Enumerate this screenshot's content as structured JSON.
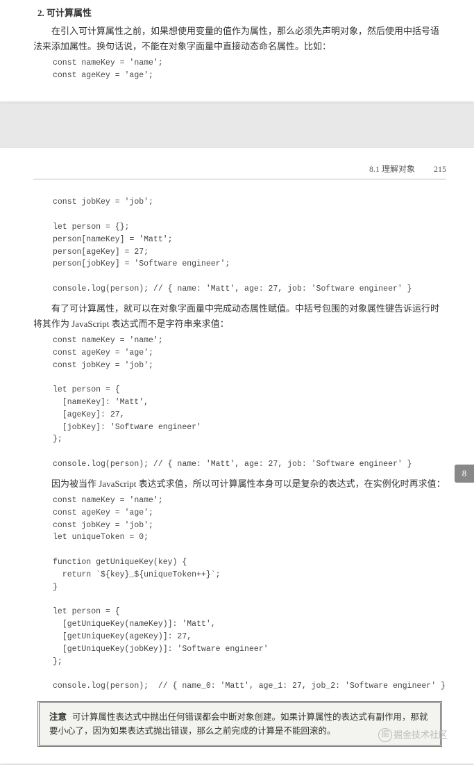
{
  "page1": {
    "heading": "2. 可计算属性",
    "para": "在引入可计算属性之前，如果想使用变量的值作为属性，那么必须先声明对象，然后使用中括号语法来添加属性。换句话说，不能在对象字面量中直接动态命名属性。比如：",
    "code": "const nameKey = 'name';\nconst ageKey = 'age';"
  },
  "page2": {
    "header_section": "8.1  理解对象",
    "header_page": "215",
    "code1": "const jobKey = 'job';\n\nlet person = {};\nperson[nameKey] = 'Matt';\nperson[ageKey] = 27;\nperson[jobKey] = 'Software engineer';\n\nconsole.log(person); // { name: 'Matt', age: 27, job: 'Software engineer' }",
    "para1": "有了可计算属性，就可以在对象字面量中完成动态属性赋值。中括号包围的对象属性键告诉运行时将其作为 JavaScript 表达式而不是字符串来求值：",
    "code2": "const nameKey = 'name';\nconst ageKey = 'age';\nconst jobKey = 'job';\n\nlet person = {\n  [nameKey]: 'Matt',\n  [ageKey]: 27,\n  [jobKey]: 'Software engineer'\n};\n\nconsole.log(person); // { name: 'Matt', age: 27, job: 'Software engineer' }",
    "para2": "因为被当作 JavaScript 表达式求值，所以可计算属性本身可以是复杂的表达式，在实例化时再求值：",
    "code3": "const nameKey = 'name';\nconst ageKey = 'age';\nconst jobKey = 'job';\nlet uniqueToken = 0;\n\nfunction getUniqueKey(key) {\n  return `${key}_${uniqueToken++}`;\n}\n\nlet person = {\n  [getUniqueKey(nameKey)]: 'Matt',\n  [getUniqueKey(ageKey)]: 27,\n  [getUniqueKey(jobKey)]: 'Software engineer'\n};\n\nconsole.log(person);  // { name_0: 'Matt', age_1: 27, job_2: 'Software engineer' }",
    "note_label": "注意",
    "note_text": "可计算属性表达式中抛出任何错误都会中断对象创建。如果计算属性的表达式有副作用，那就要小心了，因为如果表达式抛出错误，那么之前完成的计算是不能回滚的。",
    "tab": "8",
    "watermark": "掘金技术社区"
  }
}
